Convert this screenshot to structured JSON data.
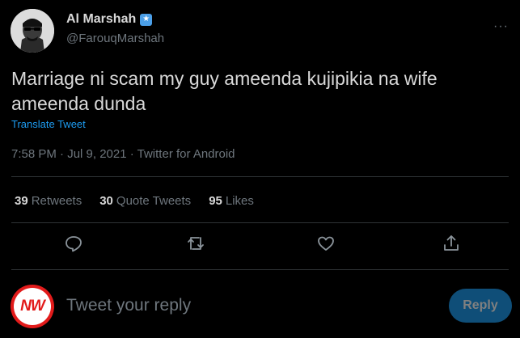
{
  "author": {
    "name": "Al Marshah",
    "verified_badge": "★",
    "handle": "@FarouqMarshah",
    "more_icon": "···"
  },
  "tweet": {
    "text": "Marriage ni scam my guy ameenda kujipikia na wife ameenda dunda",
    "translate_label": "Translate Tweet",
    "timestamp": "7:58 PM · Jul 9, 2021 · Twitter for Android"
  },
  "stats": {
    "retweets_count": "39",
    "retweets_label": "Retweets",
    "quotes_count": "30",
    "quotes_label": "Quote Tweets",
    "likes_count": "95",
    "likes_label": "Likes"
  },
  "actions": [
    "reply-icon",
    "retweet-icon",
    "like-icon",
    "share-icon"
  ],
  "reply_box": {
    "avatar_text": "NW",
    "placeholder": "Tweet your reply",
    "button_label": "Reply"
  },
  "colors": {
    "background": "#000000",
    "accent": "#1d9bf0",
    "muted": "#6e767d",
    "nw_red": "#e21b1b"
  }
}
